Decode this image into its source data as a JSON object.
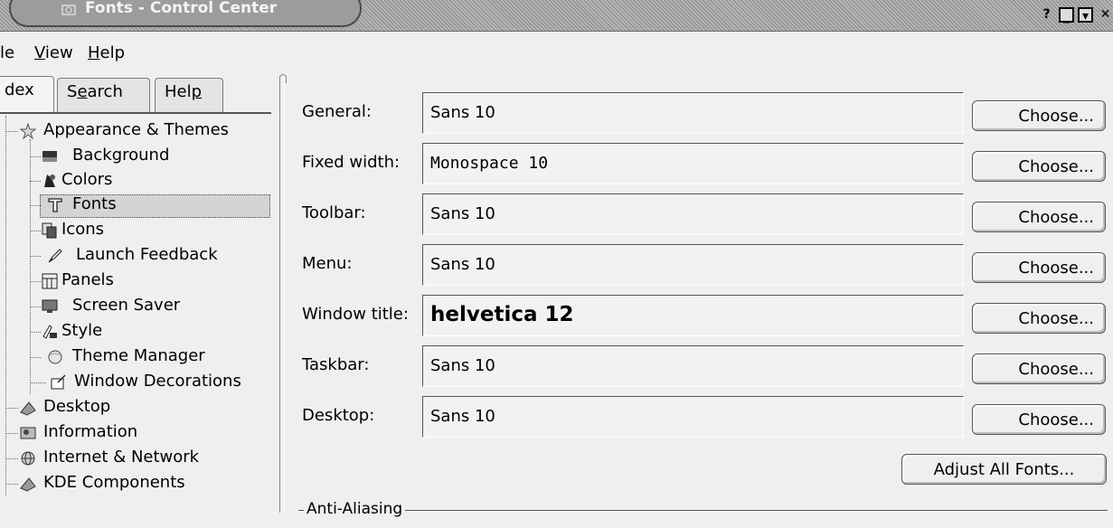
{
  "window": {
    "title": "Fonts - Control Center",
    "buttons": {
      "help": "?",
      "minimize": "_",
      "maximize": "▾",
      "close": "✕"
    }
  },
  "menubar": {
    "items": [
      {
        "label": "le",
        "accel": ""
      },
      {
        "label": "iew",
        "accel": "V"
      },
      {
        "label": "elp",
        "accel": "H"
      }
    ]
  },
  "tabs": [
    {
      "label": "dex"
    },
    {
      "label_pre": "S",
      "accel": "e",
      "label_post": "arch"
    },
    {
      "label_pre": "Hel",
      "accel": "p",
      "label_post": ""
    }
  ],
  "tree": {
    "groups": [
      {
        "label": "Appearance & Themes",
        "icon": "appearance-star-icon"
      },
      {
        "label": "Desktop",
        "icon": "desktop-icon"
      },
      {
        "label": "Information",
        "icon": "information-icon"
      },
      {
        "label": "Internet & Network",
        "icon": "network-globe-icon"
      },
      {
        "label": "KDE Components",
        "icon": "kde-components-icon"
      }
    ],
    "items": [
      {
        "label": "Background",
        "icon": "background-icon"
      },
      {
        "label": "Colors",
        "icon": "colors-icon"
      },
      {
        "label": "Fonts",
        "icon": "fonts-icon",
        "selected": true
      },
      {
        "label": "Icons",
        "icon": "icons-icon"
      },
      {
        "label": "Launch Feedback",
        "icon": "launch-feedback-icon"
      },
      {
        "label": "Panels",
        "icon": "panels-icon"
      },
      {
        "label": "Screen Saver",
        "icon": "screen-saver-icon"
      },
      {
        "label": "Style",
        "icon": "style-icon"
      },
      {
        "label": "Theme Manager",
        "icon": "theme-manager-icon"
      },
      {
        "label": "Window Decorations",
        "icon": "window-decorations-icon"
      }
    ]
  },
  "fonts": [
    {
      "label": "General:",
      "value": "Sans 10",
      "button": "Choose..."
    },
    {
      "label": "Fixed width:",
      "value": "Monospace 10",
      "button": "Choose..."
    },
    {
      "label": "Toolbar:",
      "value": "Sans 10",
      "button": "Choose..."
    },
    {
      "label": "Menu:",
      "value": "Sans 10",
      "button": "Choose..."
    },
    {
      "label": "Window title:",
      "value": "helvetica 12",
      "button": "Choose..."
    },
    {
      "label": "Taskbar:",
      "value": "Sans 10",
      "button": "Choose..."
    },
    {
      "label": "Desktop:",
      "value": "Sans 10",
      "button": "Choose..."
    }
  ],
  "adjust_all_label": "Adjust All Fonts...",
  "anti_aliasing_label": "Anti-Aliasing"
}
